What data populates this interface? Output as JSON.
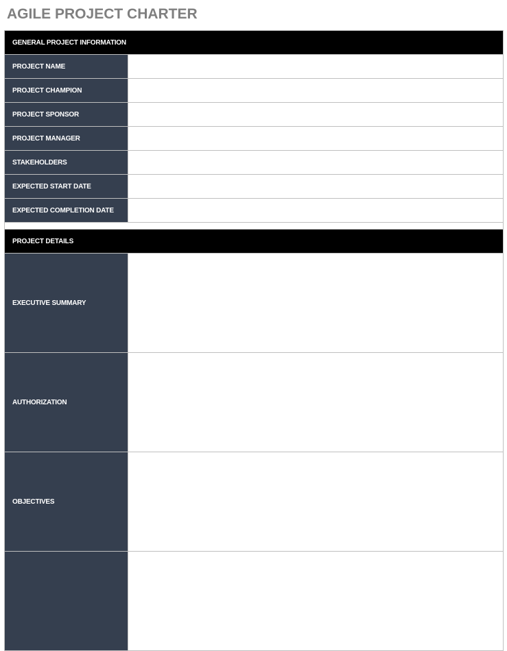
{
  "title": "AGILE PROJECT CHARTER",
  "sections": [
    {
      "header": "GENERAL PROJECT INFORMATION",
      "rows": [
        {
          "label": "PROJECT NAME",
          "value": ""
        },
        {
          "label": "PROJECT CHAMPION",
          "value": ""
        },
        {
          "label": "PROJECT SPONSOR",
          "value": ""
        },
        {
          "label": "PROJECT MANAGER",
          "value": ""
        },
        {
          "label": "STAKEHOLDERS",
          "value": ""
        },
        {
          "label": "EXPECTED START DATE",
          "value": ""
        },
        {
          "label": "EXPECTED COMPLETION DATE",
          "value": ""
        }
      ]
    },
    {
      "header": "PROJECT DETAILS",
      "rows": [
        {
          "label": "EXECUTIVE SUMMARY",
          "value": ""
        },
        {
          "label": "AUTHORIZATION",
          "value": ""
        },
        {
          "label": "OBJECTIVES",
          "value": ""
        },
        {
          "label": "",
          "value": ""
        }
      ]
    }
  ]
}
